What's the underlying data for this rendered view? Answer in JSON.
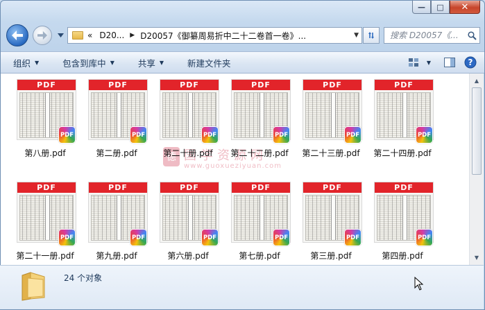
{
  "window": {
    "caption": {
      "minimize": "—",
      "maximize": "□",
      "close": "✕"
    }
  },
  "nav": {
    "back_icon": "back-arrow-icon",
    "forward_icon": "forward-arrow-icon"
  },
  "address": {
    "prefix": "«",
    "crumbs": [
      "D20...",
      "D20057《御纂周易折中二十二卷首一卷》..."
    ]
  },
  "search": {
    "placeholder": "搜索 D20057《..."
  },
  "toolbar": {
    "organize": "组织",
    "include_library": "包含到库中",
    "share": "共享",
    "new_folder": "新建文件夹"
  },
  "files": [
    {
      "name": "第八册.pdf"
    },
    {
      "name": "第二册.pdf"
    },
    {
      "name": "第二十册.pdf"
    },
    {
      "name": "第二十二册.pdf"
    },
    {
      "name": "第二十三册.pdf"
    },
    {
      "name": "第二十四册.pdf"
    },
    {
      "name": "第二十一册.pdf"
    },
    {
      "name": "第九册.pdf"
    },
    {
      "name": "第六册.pdf"
    },
    {
      "name": "第七册.pdf"
    },
    {
      "name": "第三册.pdf"
    },
    {
      "name": "第四册.pdf"
    }
  ],
  "thumb_banner": "PDF",
  "pdf_badge": "PDF",
  "watermark": {
    "logo": "德",
    "text": "国学资源网",
    "url": "www.guoxueziyuan.com"
  },
  "status": {
    "count": "24 个对象"
  },
  "colors": {
    "pdf_banner": "#e2242a",
    "accent": "#1e395b"
  }
}
